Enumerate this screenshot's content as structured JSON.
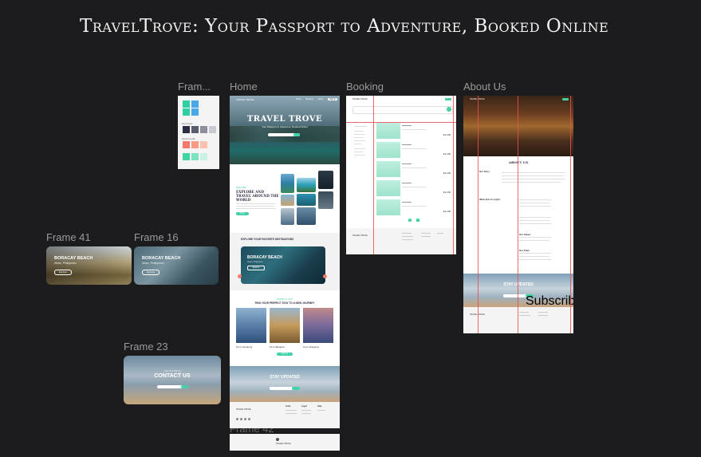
{
  "title": "TravelTrove: Your Passport to Adventure, Booked Online",
  "frames": {
    "frame_palette": "Fram...",
    "home": "Home",
    "booking": "Booking",
    "about": "About Us",
    "frame41": "Frame 41",
    "frame16": "Frame 16",
    "frame23": "Frame 23",
    "frame42": "Frame 42"
  },
  "palette": {
    "header1": "",
    "header2": "Text Color",
    "header3": "Accent Color",
    "colors": [
      "#2ecfa0",
      "#4aa8e8",
      "#2b2d42",
      "#5a5d6e",
      "#8b8f9c",
      "#c7cad1",
      "#f4796b",
      "#f89b85",
      "#fbc0ae",
      "#3fd6a3",
      "#7be3bf",
      "#c9f2e2"
    ]
  },
  "home": {
    "brand": "TRAVEL TROVE",
    "hero_title": "TRAVEL TROVE",
    "hero_sub": "Your Passport to Adventure, Booked Online",
    "nav": [
      "Home",
      "Booking",
      "About",
      "Sign In"
    ],
    "explore_tag": "WELCOME",
    "explore_title": "EXPLORE AND TRAVEL AROUND THE WORLD",
    "explore_btn": "Book",
    "dest_title": "EXPLORE YOUR FAVORITE DESTINATIONS",
    "dest_card_title": "BORACAY BEACH",
    "dest_card_sub": "Aklan, Philippines",
    "dest_card_btn": "Explore",
    "stay_tag": "WHERE TO STAY",
    "stay_title": "FIND YOUR PERFECT STAY TO A NEW JOURNEY",
    "stays": [
      "Fly to Hongkong",
      "Fly to Bangkok",
      "Fly to Singapore"
    ],
    "stay_btn": "Explore",
    "newsletter_title": "STAY UPDATED",
    "newsletter_btn": "Subscribe",
    "footer_cols": [
      "Links",
      "Legal",
      "Help"
    ]
  },
  "booking": {
    "brand": "TRAVEL TROVE",
    "prices": [
      "$1,200",
      "$1,200",
      "$1,200",
      "$1,200",
      "$1,200"
    ],
    "pagination": [
      "1",
      "2"
    ]
  },
  "about": {
    "brand": "TRAVEL TROVE",
    "heading": "ABOUT US",
    "sections": [
      "Our Story",
      "What Sets Us Apart",
      "Our Values",
      "Our Team"
    ],
    "newsletter_title": "STAY UPDATED",
    "newsletter_btn": "Subscribe"
  },
  "cards": {
    "frame41": {
      "title": "BORACAY BEACH",
      "sub": "Aklan, Philippines",
      "btn": "Explore"
    },
    "frame16": {
      "title": "BORACAY BEACH",
      "sub": "Aklan, Philippines",
      "btn": "Explore"
    },
    "frame23": {
      "title": "CONTACT US",
      "tag": "GET IN TOUCH",
      "btn": "Send"
    }
  }
}
